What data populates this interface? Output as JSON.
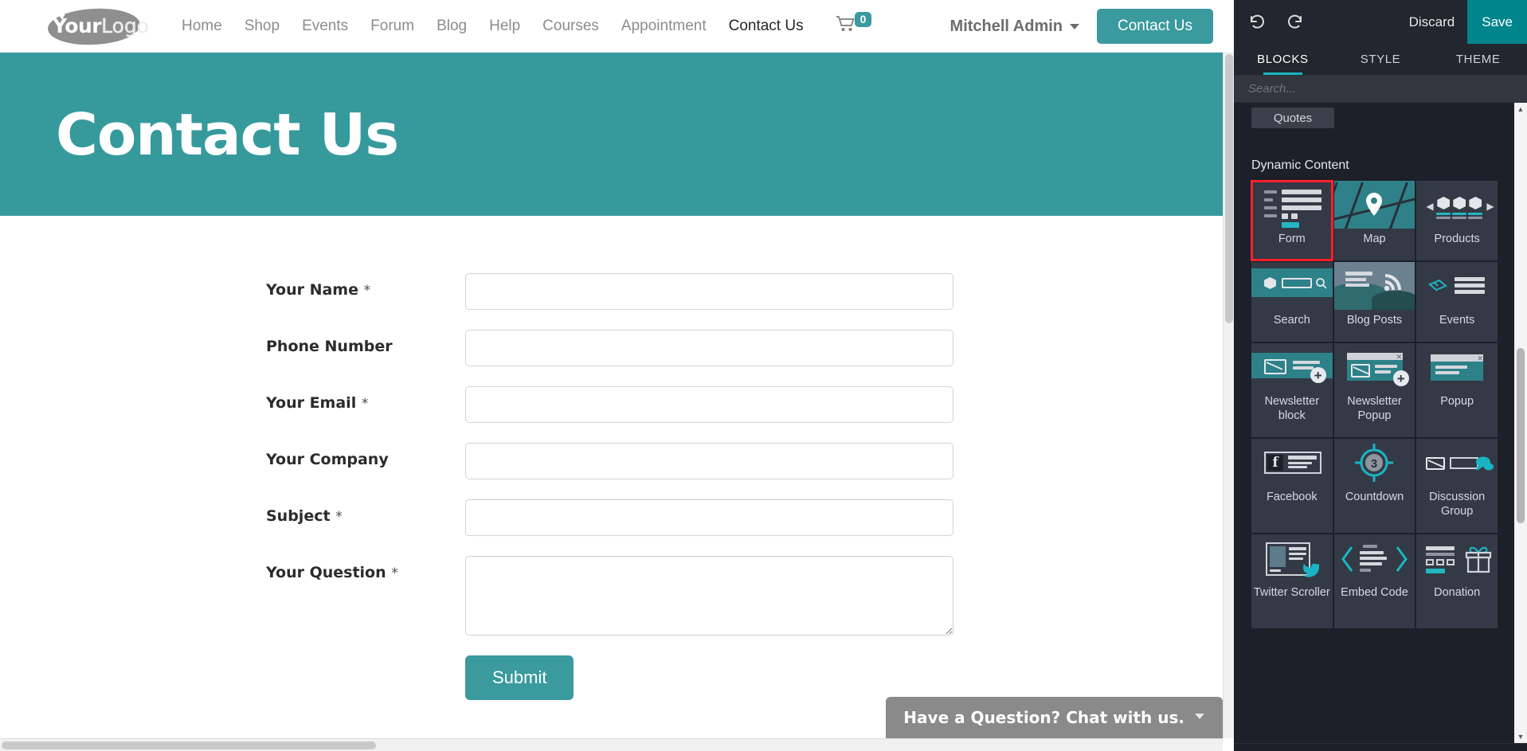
{
  "website": {
    "logo": {
      "bold_text": "Your",
      "light_text": "Logo",
      "name": "YourLogo"
    },
    "menu": [
      {
        "label": "Home",
        "active": false
      },
      {
        "label": "Shop",
        "active": false
      },
      {
        "label": "Events",
        "active": false
      },
      {
        "label": "Forum",
        "active": false
      },
      {
        "label": "Blog",
        "active": false
      },
      {
        "label": "Help",
        "active": false
      },
      {
        "label": "Courses",
        "active": false
      },
      {
        "label": "Appointment",
        "active": false
      },
      {
        "label": "Contact Us",
        "active": true
      }
    ],
    "cart": {
      "count": "0",
      "badge_color": "#3a9a9d"
    },
    "user": {
      "name": "Mitchell Admin"
    },
    "cta_button": {
      "label": "Contact Us",
      "color": "#3a9a9d"
    },
    "hero": {
      "title": "Contact Us",
      "bg_color": "#369a9c"
    },
    "chat_widget": {
      "label": "Have a Question? Chat with us."
    }
  },
  "form": {
    "fields": [
      {
        "label": "Your Name",
        "required": true,
        "value": "",
        "placeholder": "",
        "type": "text"
      },
      {
        "label": "Phone Number",
        "required": false,
        "value": "",
        "placeholder": "",
        "type": "text"
      },
      {
        "label": "Your Email",
        "required": true,
        "value": "",
        "placeholder": "",
        "type": "email"
      },
      {
        "label": "Your Company",
        "required": false,
        "value": "",
        "placeholder": "",
        "type": "text"
      },
      {
        "label": "Subject",
        "required": true,
        "value": "",
        "placeholder": "",
        "type": "text"
      },
      {
        "label": "Your Question",
        "required": true,
        "value": "",
        "placeholder": "",
        "type": "textarea"
      }
    ],
    "required_marker": "*",
    "submit_label": "Submit",
    "submit_color": "#3a9a9d"
  },
  "editor": {
    "undo_icon": "undo-icon",
    "redo_icon": "redo-icon",
    "discard_label": "Discard",
    "save_label": "Save",
    "save_color": "#00858c",
    "tabs": [
      {
        "label": "BLOCKS",
        "active": true
      },
      {
        "label": "STYLE",
        "active": false
      },
      {
        "label": "THEME",
        "active": false
      }
    ],
    "search": {
      "placeholder": "Search...",
      "value": ""
    },
    "partial_tile_above": "Quotes",
    "category": "Dynamic Content",
    "blocks": [
      {
        "label": "Form",
        "icon": "form-icon",
        "selected": true
      },
      {
        "label": "Map",
        "icon": "map-pin-icon",
        "selected": false
      },
      {
        "label": "Products",
        "icon": "products-carousel-icon",
        "selected": false
      },
      {
        "label": "Search",
        "icon": "product-search-icon",
        "selected": false
      },
      {
        "label": "Blog Posts",
        "icon": "rss-landscape-icon",
        "selected": false
      },
      {
        "label": "Events",
        "icon": "ticket-icon",
        "selected": false
      },
      {
        "label": "Newsletter block",
        "icon": "envelope-plus-icon",
        "selected": false
      },
      {
        "label": "Newsletter Popup",
        "icon": "envelope-popup-plus-icon",
        "selected": false
      },
      {
        "label": "Popup",
        "icon": "popup-window-icon",
        "selected": false
      },
      {
        "label": "Facebook",
        "icon": "facebook-card-icon",
        "selected": false
      },
      {
        "label": "Countdown",
        "icon": "countdown-target-icon",
        "selected": false
      },
      {
        "label": "Discussion Group",
        "icon": "discussion-chat-icon",
        "selected": false
      },
      {
        "label": "Twitter Scroller",
        "icon": "twitter-bird-icon",
        "selected": false
      },
      {
        "label": "Embed Code",
        "icon": "embed-chevrons-icon",
        "selected": false
      },
      {
        "label": "Donation",
        "icon": "gift-box-icon",
        "selected": false
      }
    ],
    "accent_color": "#1ab5c4",
    "selection_highlight_color": "#ff1f2d"
  }
}
